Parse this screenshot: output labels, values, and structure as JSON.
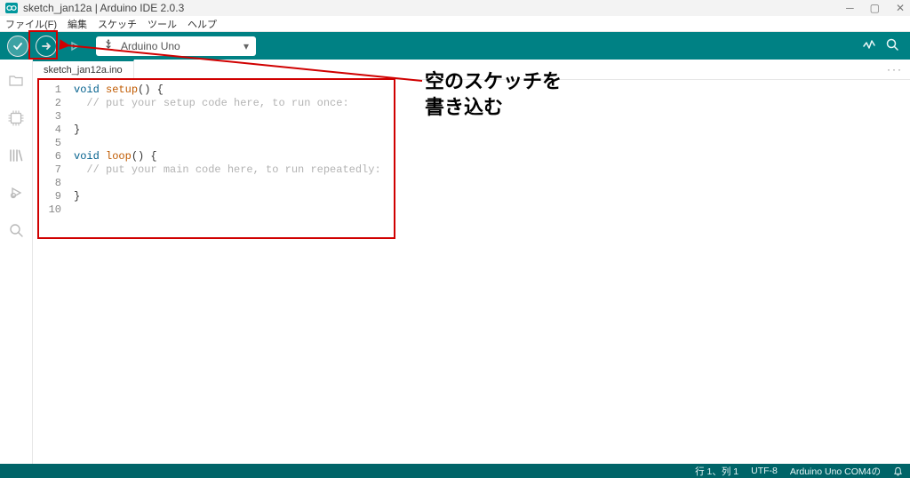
{
  "window": {
    "title": "sketch_jan12a | Arduino IDE 2.0.3"
  },
  "menu": {
    "file": "ファイル(F)",
    "edit": "編集",
    "sketch": "スケッチ",
    "tools": "ツール",
    "help": "ヘルプ"
  },
  "board_selector": {
    "label": "Arduino Uno"
  },
  "tabs": {
    "active": "sketch_jan12a.ino",
    "more": "···"
  },
  "code_lines": [
    [
      {
        "t": "kw",
        "v": "void"
      },
      {
        "t": "sp",
        "v": " "
      },
      {
        "t": "fn",
        "v": "setup"
      },
      {
        "t": "punc",
        "v": "() {"
      }
    ],
    [
      {
        "t": "indent",
        "v": "  "
      },
      {
        "t": "cmt",
        "v": "// put your setup code here, to run once:"
      }
    ],
    [],
    [
      {
        "t": "punc",
        "v": "}"
      }
    ],
    [],
    [
      {
        "t": "kw",
        "v": "void"
      },
      {
        "t": "sp",
        "v": " "
      },
      {
        "t": "fn",
        "v": "loop"
      },
      {
        "t": "punc",
        "v": "() {"
      }
    ],
    [
      {
        "t": "indent",
        "v": "  "
      },
      {
        "t": "cmt",
        "v": "// put your main code here, to run repeatedly:"
      }
    ],
    [],
    [
      {
        "t": "punc",
        "v": "}"
      }
    ],
    []
  ],
  "status": {
    "pos": "行 1、列 1",
    "encoding": "UTF-8",
    "board_port": "Arduino Uno COM4の"
  },
  "annotation": {
    "line1": "空のスケッチを",
    "line2": "書き込む"
  }
}
